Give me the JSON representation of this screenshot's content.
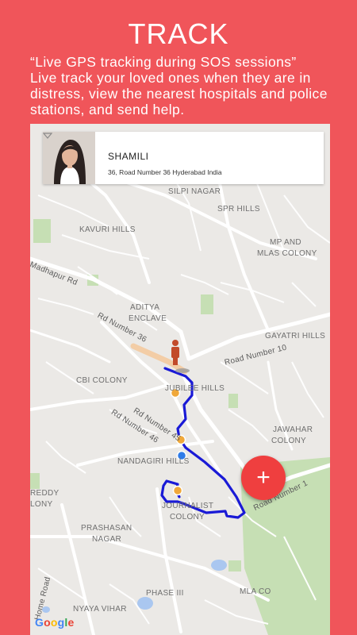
{
  "header": {
    "title": "TRACK",
    "quote": "“Live GPS tracking during SOS sessions”",
    "description": "Live track your loved ones when they are in distress, view the nearest hospitals and police stations, and send help."
  },
  "contact_card": {
    "name": "SHAMILI",
    "address": "36, Road Number 36 Hyderabad India",
    "dropdown_icon": "chevron-down-icon"
  },
  "map": {
    "labels": {
      "silpi_nagar": "SILPI NAGAR",
      "spr_hills": "SPR HILLS",
      "kavuri_hills": "KAVURI HILLS",
      "mp_mlas_1": "MP AND",
      "mp_mlas_2": "MLAS COLONY",
      "madhapur_rd": "Madhapur Rd",
      "aditya_1": "ADITYA",
      "aditya_2": "ENCLAVE",
      "rd36": "Rd Number 36",
      "gayatri": "GAYATRI HILLS",
      "road10": "Road Number 10",
      "cbi": "CBI COLONY",
      "jubilee": "JUBILEE HILLS",
      "rd45": "Rd Number 45",
      "rd46": "Rd Number 46",
      "jawahar_1": "JAWAHAR",
      "jawahar_2": "COLONY",
      "nandagiri": "NANDAGIRI HILLS",
      "reddy_1": "REDDY",
      "reddy_2": "LONY",
      "journalist_1": "JOURNALIST",
      "journalist_2": "COLONY",
      "road1": "Road Number 1",
      "prashasan_1": "PRASHASAN",
      "prashasan_2": "NAGAR",
      "phase3": "PHASE III",
      "mla": "MLA CO",
      "nyaya": "NYAYA VIHAR",
      "home_road": "Home Road",
      "google": "Google"
    },
    "route_color": "#1a1ad6",
    "accent": "#f0555a"
  },
  "fab": {
    "label": "+",
    "icon": "plus-icon"
  }
}
